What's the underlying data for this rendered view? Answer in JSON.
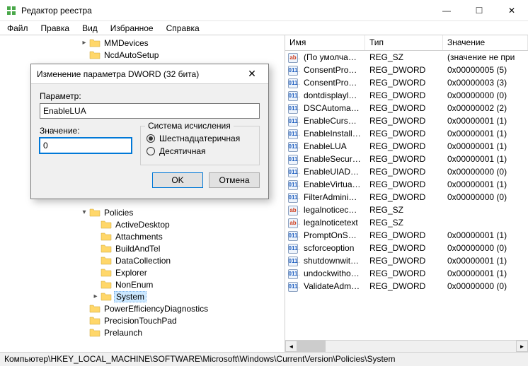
{
  "window": {
    "title": "Редактор реестра"
  },
  "menu": [
    "Файл",
    "Правка",
    "Вид",
    "Избранное",
    "Справка"
  ],
  "tree_top": [
    {
      "indent": 112,
      "toggle": ">",
      "label": "MMDevices"
    },
    {
      "indent": 112,
      "toggle": "",
      "label": "NcdAutoSetup"
    }
  ],
  "tree_bottom": [
    {
      "indent": 112,
      "toggle": "v",
      "label": "Policies",
      "open": true
    },
    {
      "indent": 128,
      "toggle": "",
      "label": "ActiveDesktop"
    },
    {
      "indent": 128,
      "toggle": "",
      "label": "Attachments"
    },
    {
      "indent": 128,
      "toggle": "",
      "label": "BuildAndTel"
    },
    {
      "indent": 128,
      "toggle": "",
      "label": "DataCollection"
    },
    {
      "indent": 128,
      "toggle": "",
      "label": "Explorer"
    },
    {
      "indent": 128,
      "toggle": "",
      "label": "NonEnum"
    },
    {
      "indent": 128,
      "toggle": ">",
      "label": "System",
      "sel": true
    },
    {
      "indent": 112,
      "toggle": "",
      "label": "PowerEfficiencyDiagnostics"
    },
    {
      "indent": 112,
      "toggle": "",
      "label": "PrecisionTouchPad"
    },
    {
      "indent": 112,
      "toggle": "",
      "label": "Prelaunch"
    }
  ],
  "list_head": {
    "name": "Имя",
    "type": "Тип",
    "value": "Значение"
  },
  "list": [
    {
      "icon": "str",
      "name": "(По умолчанию)",
      "type": "REG_SZ",
      "value": "(значение не при"
    },
    {
      "icon": "dw",
      "name": "ConsentPrompt...",
      "type": "REG_DWORD",
      "value": "0x00000005 (5)"
    },
    {
      "icon": "dw",
      "name": "ConsentPrompt...",
      "type": "REG_DWORD",
      "value": "0x00000003 (3)"
    },
    {
      "icon": "dw",
      "name": "dontdisplaylastu...",
      "type": "REG_DWORD",
      "value": "0x00000000 (0)"
    },
    {
      "icon": "dw",
      "name": "DSCAutomation...",
      "type": "REG_DWORD",
      "value": "0x00000002 (2)"
    },
    {
      "icon": "dw",
      "name": "EnableCursorSu...",
      "type": "REG_DWORD",
      "value": "0x00000001 (1)"
    },
    {
      "icon": "dw",
      "name": "EnableInstallerD...",
      "type": "REG_DWORD",
      "value": "0x00000001 (1)"
    },
    {
      "icon": "dw",
      "name": "EnableLUA",
      "type": "REG_DWORD",
      "value": "0x00000001 (1)"
    },
    {
      "icon": "dw",
      "name": "EnableSecureUI...",
      "type": "REG_DWORD",
      "value": "0x00000001 (1)"
    },
    {
      "icon": "dw",
      "name": "EnableUIADeskt...",
      "type": "REG_DWORD",
      "value": "0x00000000 (0)"
    },
    {
      "icon": "dw",
      "name": "EnableVirtualizat...",
      "type": "REG_DWORD",
      "value": "0x00000001 (1)"
    },
    {
      "icon": "dw",
      "name": "FilterAdministra...",
      "type": "REG_DWORD",
      "value": "0x00000000 (0)"
    },
    {
      "icon": "str",
      "name": "legalnoticecapti...",
      "type": "REG_SZ",
      "value": ""
    },
    {
      "icon": "str",
      "name": "legalnoticetext",
      "type": "REG_SZ",
      "value": ""
    },
    {
      "icon": "dw",
      "name": "PromptOnSecur...",
      "type": "REG_DWORD",
      "value": "0x00000001 (1)"
    },
    {
      "icon": "dw",
      "name": "scforceoption",
      "type": "REG_DWORD",
      "value": "0x00000000 (0)"
    },
    {
      "icon": "dw",
      "name": "shutdownwitho...",
      "type": "REG_DWORD",
      "value": "0x00000001 (1)"
    },
    {
      "icon": "dw",
      "name": "undockwithoutl...",
      "type": "REG_DWORD",
      "value": "0x00000001 (1)"
    },
    {
      "icon": "dw",
      "name": "ValidateAdminC...",
      "type": "REG_DWORD",
      "value": "0x00000000 (0)"
    }
  ],
  "statusbar": "Компьютер\\HKEY_LOCAL_MACHINE\\SOFTWARE\\Microsoft\\Windows\\CurrentVersion\\Policies\\System",
  "dialog": {
    "title": "Изменение параметра DWORD (32 бита)",
    "param_label": "Параметр:",
    "param_value": "EnableLUA",
    "value_label": "Значение:",
    "value_value": "0",
    "group_title": "Система исчисления",
    "radio_hex": "Шестнадцатеричная",
    "radio_dec": "Десятичная",
    "ok": "OK",
    "cancel": "Отмена"
  }
}
